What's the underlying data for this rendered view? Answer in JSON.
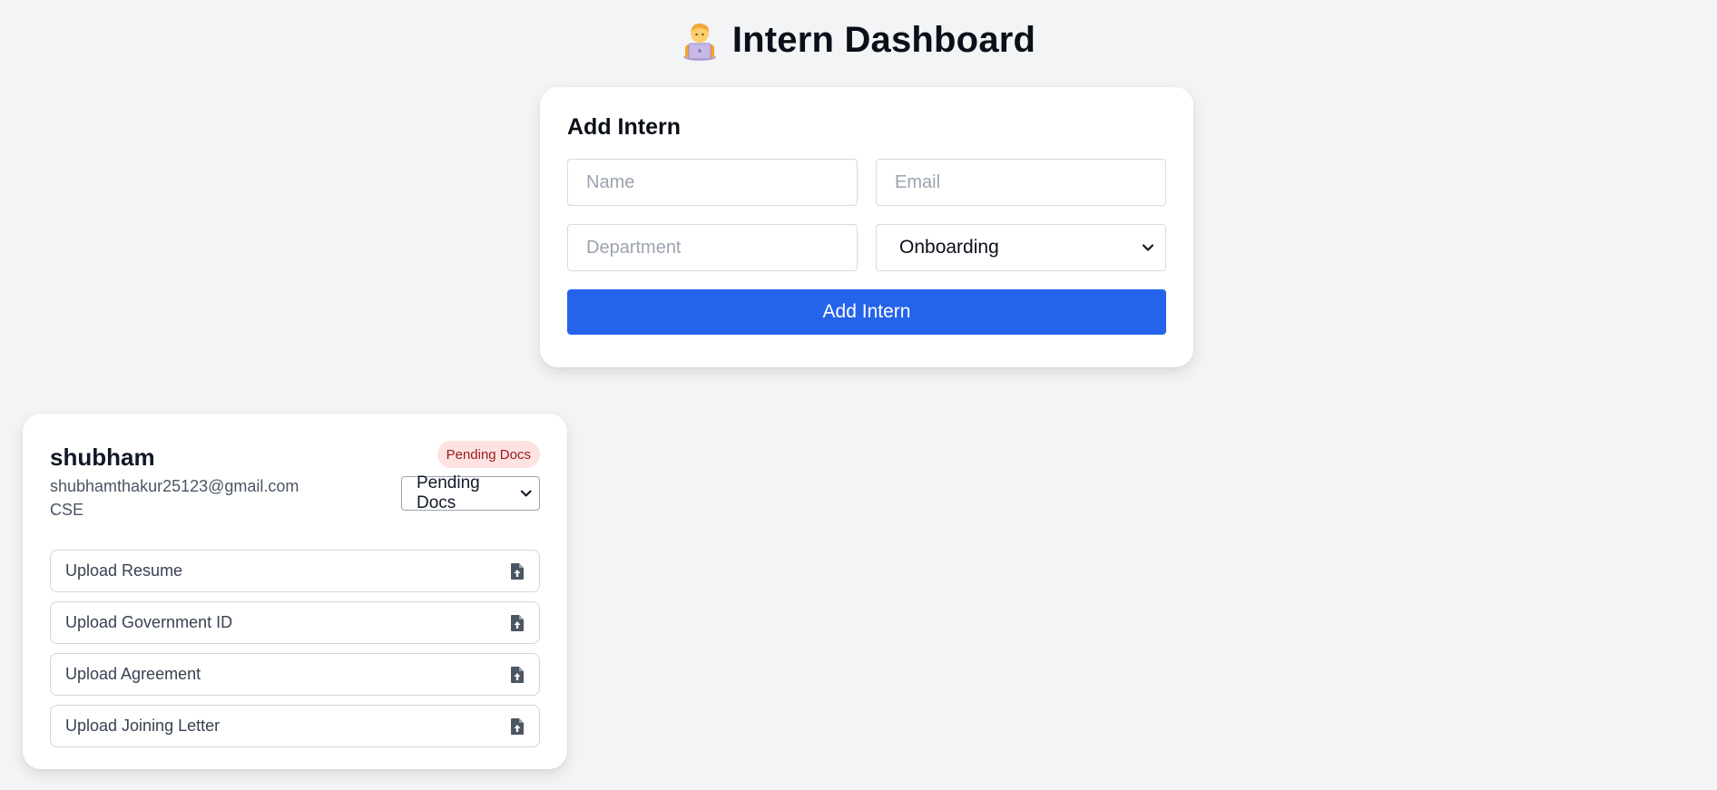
{
  "header": {
    "title": "Intern Dashboard"
  },
  "form": {
    "title": "Add Intern",
    "name_placeholder": "Name",
    "email_placeholder": "Email",
    "department_placeholder": "Department",
    "status_value": "Onboarding",
    "submit_label": "Add Intern"
  },
  "intern": {
    "name": "shubham",
    "email": "shubhamthakur25123@gmail.com",
    "department": "CSE",
    "badge": "Pending Docs",
    "status_value": "Pending Docs",
    "badge_bg": "#fee2e2",
    "badge_color": "#991b1b",
    "uploads": [
      {
        "label": "Upload Resume",
        "icon": "file-upload-icon"
      },
      {
        "label": "Upload Government ID",
        "icon": "file-upload-icon"
      },
      {
        "label": "Upload Agreement",
        "icon": "file-upload-icon"
      },
      {
        "label": "Upload Joining Letter",
        "icon": "file-upload-icon"
      }
    ]
  },
  "colors": {
    "background": "#f3f4f6",
    "accent": "#2563eb"
  }
}
